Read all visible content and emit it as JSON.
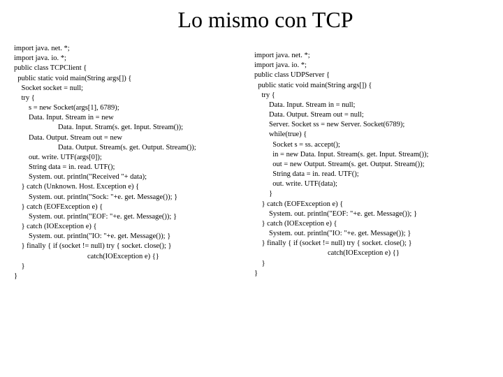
{
  "title": "Lo mismo con TCP",
  "left_code": "import java. net. *;\nimport java. io. *;\npublic class TCPClient {\n  public static void main(String args[]) {\n    Socket socket = null;\n    try {\n        s = new Socket(args[1], 6789);\n        Data. Input. Stream in = new\n                        Data. Input. Stram(s. get. Input. Stream());\n        Data. Output. Stream out = new\n                        Data. Output. Stream(s. get. Output. Stream());\n        out. write. UTF(args[0]);\n        String data = in. read. UTF();\n        System. out. println(\"Received \"+ data);\n    } catch (Unknown. Host. Exception e) {\n        System. out. println(\"Sock: \"+e. get. Message()); }\n    } catch (EOFException e) {\n        System. out. println(\"EOF: \"+e. get. Message()); }\n    } catch (IOException e) {\n        System. out. println(\"IO: \"+e. get. Message()); }\n    } finally { if (socket != null) try { socket. close(); }\n                                        catch(IOException e) {}\n    }\n}",
  "right_code": "import java. net. *;\nimport java. io. *;\npublic class UDPServer {\n  public static void main(String args[]) {\n    try {\n        Data. Input. Stream in = null;\n        Data. Output. Stream out = null;\n        Server. Socket ss = new Server. Socket(6789);\n        while(true) {\n          Socket s = ss. accept();\n          in = new Data. Input. Stream(s. get. Input. Stream());\n          out = new Output. Stream(s. get. Output. Stream());\n          String data = in. read. UTF();\n          out. write. UTF(data);\n        }\n    } catch (EOFException e) {\n        System. out. println(\"EOF: \"+e. get. Message()); }\n    } catch (IOException e) {\n        System. out. println(\"IO: \"+e. get. Message()); }\n    } finally { if (socket != null) try { socket. close(); }\n                                        catch(IOException e) {}\n    }\n}"
}
